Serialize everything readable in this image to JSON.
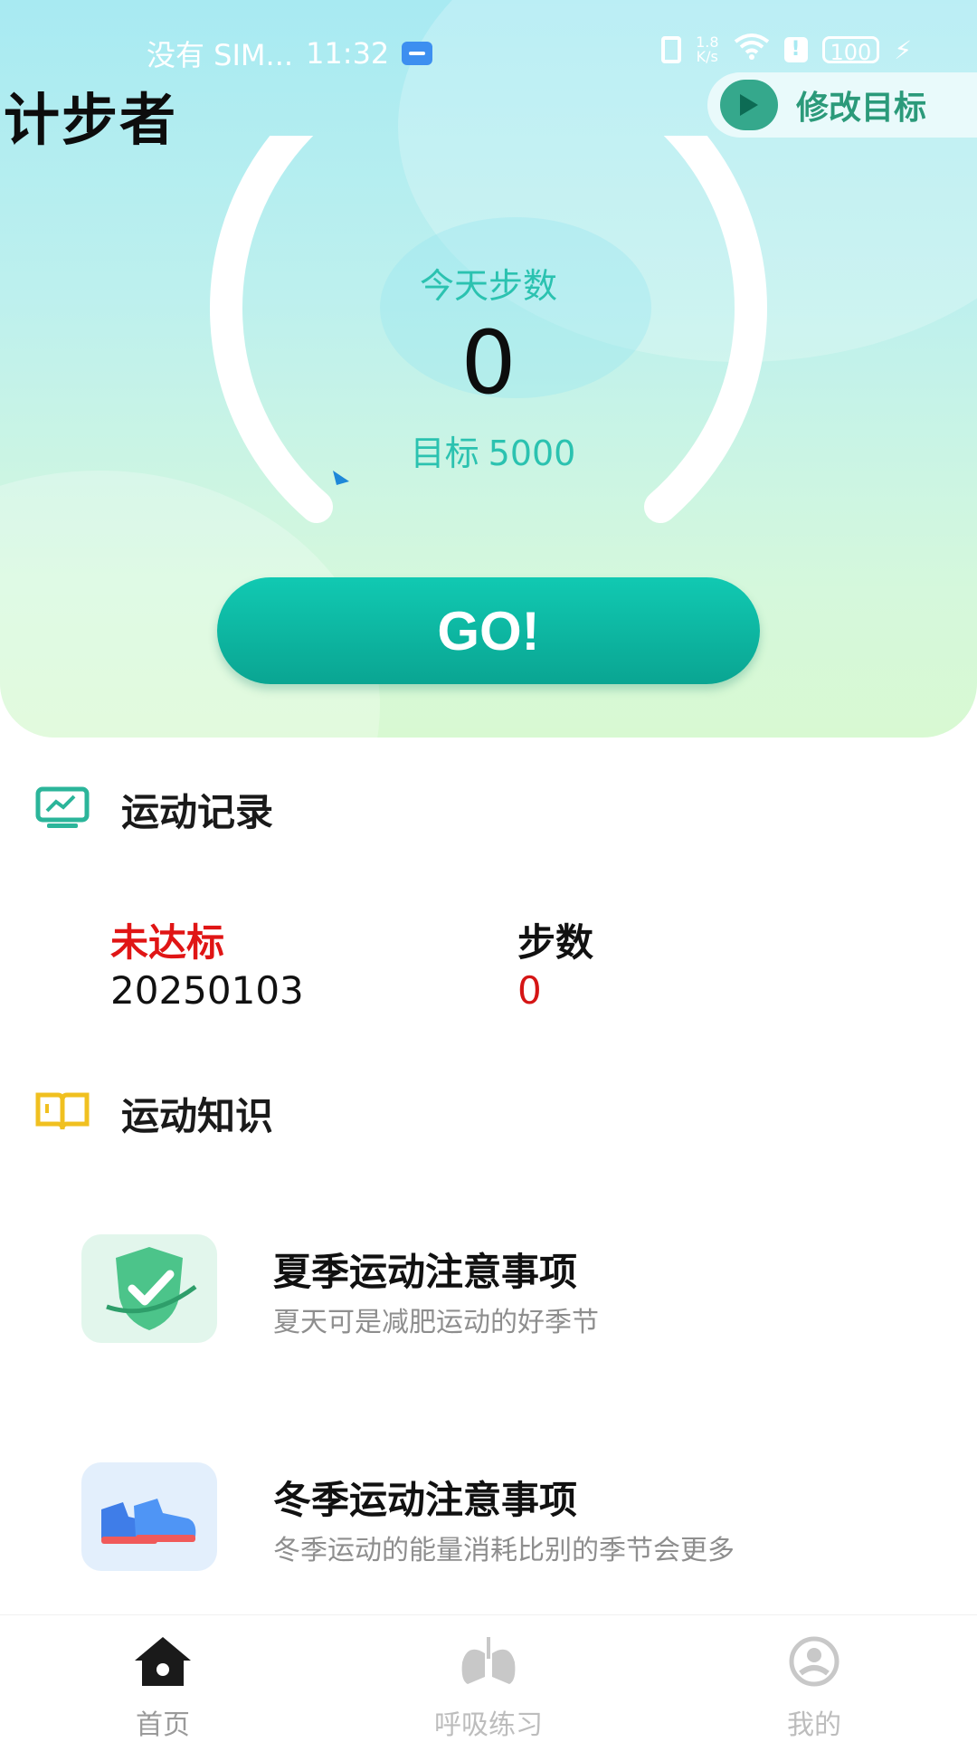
{
  "status_bar": {
    "carrier": "没有 SIM...",
    "time": "11:32",
    "net_speed_value": "1.8",
    "net_speed_unit": "K/s",
    "battery": "100"
  },
  "header": {
    "title": "计步者",
    "modify_goal_label": "修改目标"
  },
  "gauge": {
    "title": "今天步数",
    "steps": "0",
    "goal_label": "目标",
    "goal_value": "5000",
    "progress": 0
  },
  "go_button_label": "GO!",
  "records": {
    "section_title": "运动记录",
    "status_label": "未达标",
    "date": "20250103",
    "steps_label": "步数",
    "steps_value": "0"
  },
  "knowledge": {
    "section_title": "运动知识",
    "articles": [
      {
        "title": "夏季运动注意事项",
        "subtitle": "夏天可是减肥运动的好季节",
        "icon": "shield-check-icon"
      },
      {
        "title": "冬季运动注意事项",
        "subtitle": "冬季运动的能量消耗比别的季节会更多",
        "icon": "sneakers-icon"
      }
    ]
  },
  "bottom_nav": [
    {
      "label": "首页",
      "icon": "home-icon",
      "active": true
    },
    {
      "label": "呼吸练习",
      "icon": "lungs-icon",
      "active": false
    },
    {
      "label": "我的",
      "icon": "profile-icon",
      "active": false
    }
  ],
  "colors": {
    "accent": "#2bc2b0",
    "go_button": "#0fb8a3",
    "not_met": "#e01515"
  }
}
